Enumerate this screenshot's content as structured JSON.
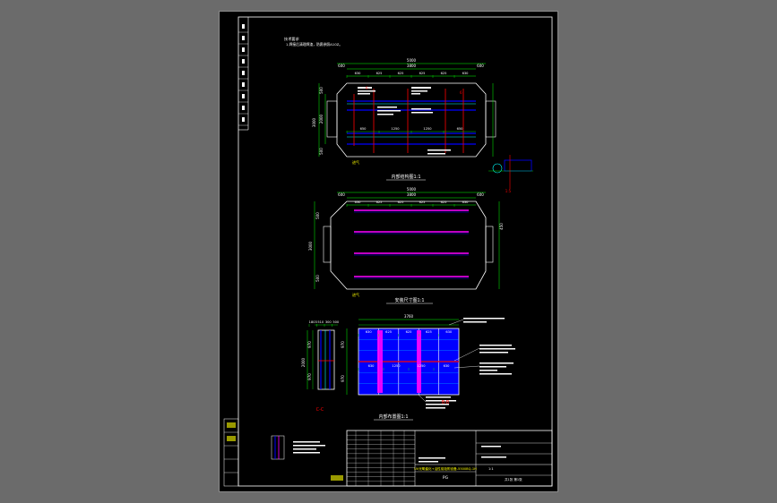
{
  "canvas_background": "#6b6b6b",
  "sheet_background": "#000000",
  "colors": {
    "outline": "#ffffff",
    "dimension": "#00ff00",
    "tray": "#0000ff",
    "partition": "#ff00ff",
    "section_line": "#ff0000",
    "mesh_line": "#00ffff",
    "annotation": "#ffff00"
  },
  "technical_note": {
    "heading": "技术要求",
    "line1": "1.焊接后清理焊渣，防腐参照A10Z。"
  },
  "views": {
    "top": {
      "caption": "内部结构图1:1",
      "dim_overall": "5000",
      "dim_inner": "3800",
      "dim_left": "600",
      "dim_right": "600",
      "dim_bays": [
        "630",
        "625",
        "625",
        "625",
        "625",
        "630"
      ],
      "dim_lower": [
        "650",
        "1250",
        "1250",
        "650"
      ],
      "dim_height": "3000",
      "dim_height_inner": "2000",
      "dim_side_top": "500",
      "dim_side_bottom": "500",
      "marker_left": "6",
      "marker_right": "6",
      "inlet_label": "进气",
      "outlet_label": "出气"
    },
    "middle": {
      "caption": "安装尺寸图1:1",
      "dim_overall": "5000",
      "dim_inner": "3800",
      "dim_left": "600",
      "dim_right": "600",
      "dim_bays": [
        "630",
        "625",
        "625",
        "625",
        "625",
        "630"
      ],
      "dim_height": "3000",
      "dim_side_top": "500",
      "dim_side_bottom": "500",
      "dim_right_side": "450",
      "inlet_label": "进气"
    },
    "bottom_left": {
      "caption": "C-C",
      "dim_top": [
        "1803",
        "510",
        "300",
        "500"
      ],
      "dim_height": "2000",
      "dim_parts": [
        "970",
        "970"
      ]
    },
    "bottom_main": {
      "caption": "内部布置图1:1",
      "section": "B-B",
      "dim_overall": "3760",
      "dim_bays_top": [
        "630",
        "625",
        "625",
        "625",
        "630"
      ],
      "dim_bays_mid": [
        "630",
        "1250",
        "1250",
        "630"
      ],
      "dim_side": [
        "970",
        "970"
      ]
    },
    "detail": {
      "caption": "1:5"
    }
  },
  "revision_table": {
    "rows": [
      "12",
      "11",
      "10",
      "9",
      "8",
      "7",
      "6",
      "5",
      "4",
      "3",
      "2",
      "1"
    ]
  },
  "title_block": {
    "drawing_name": "UV光氧催化+活性炭吸附设备-5500BQ-1H",
    "code": "PG",
    "scale": "1:1",
    "sheet": "共1张 第1张"
  }
}
